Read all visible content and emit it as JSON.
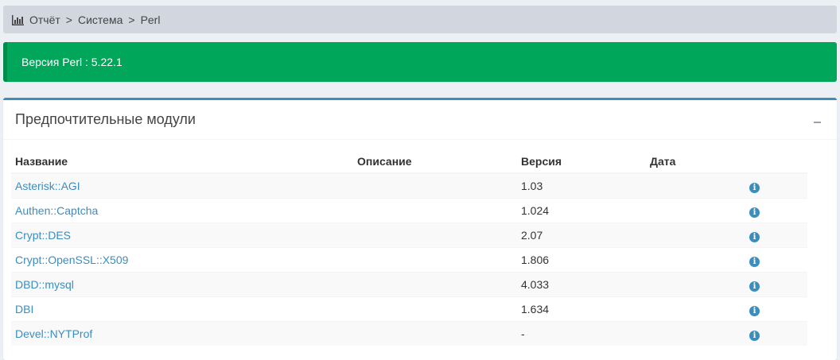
{
  "breadcrumb": {
    "icon": "bar-chart-icon",
    "items": [
      "Отчёт",
      "Система",
      "Perl"
    ],
    "separator": ">"
  },
  "alert": {
    "text": "Версия Perl : 5.22.1",
    "color": "#00a65a"
  },
  "box": {
    "title": "Предпочтительные модули",
    "accent": "#3c8dbc"
  },
  "table": {
    "headers": [
      "Название",
      "Описание",
      "Версия",
      "Дата"
    ],
    "rows": [
      {
        "name": "Asterisk::AGI",
        "description": "",
        "version": "1.03",
        "date": ""
      },
      {
        "name": "Authen::Captcha",
        "description": "",
        "version": "1.024",
        "date": ""
      },
      {
        "name": "Crypt::DES",
        "description": "",
        "version": "2.07",
        "date": ""
      },
      {
        "name": "Crypt::OpenSSL::X509",
        "description": "",
        "version": "1.806",
        "date": ""
      },
      {
        "name": "DBD::mysql",
        "description": "",
        "version": "4.033",
        "date": ""
      },
      {
        "name": "DBI",
        "description": "",
        "version": "1.634",
        "date": ""
      },
      {
        "name": "Devel::NYTProf",
        "description": "",
        "version": "-",
        "date": ""
      }
    ]
  }
}
